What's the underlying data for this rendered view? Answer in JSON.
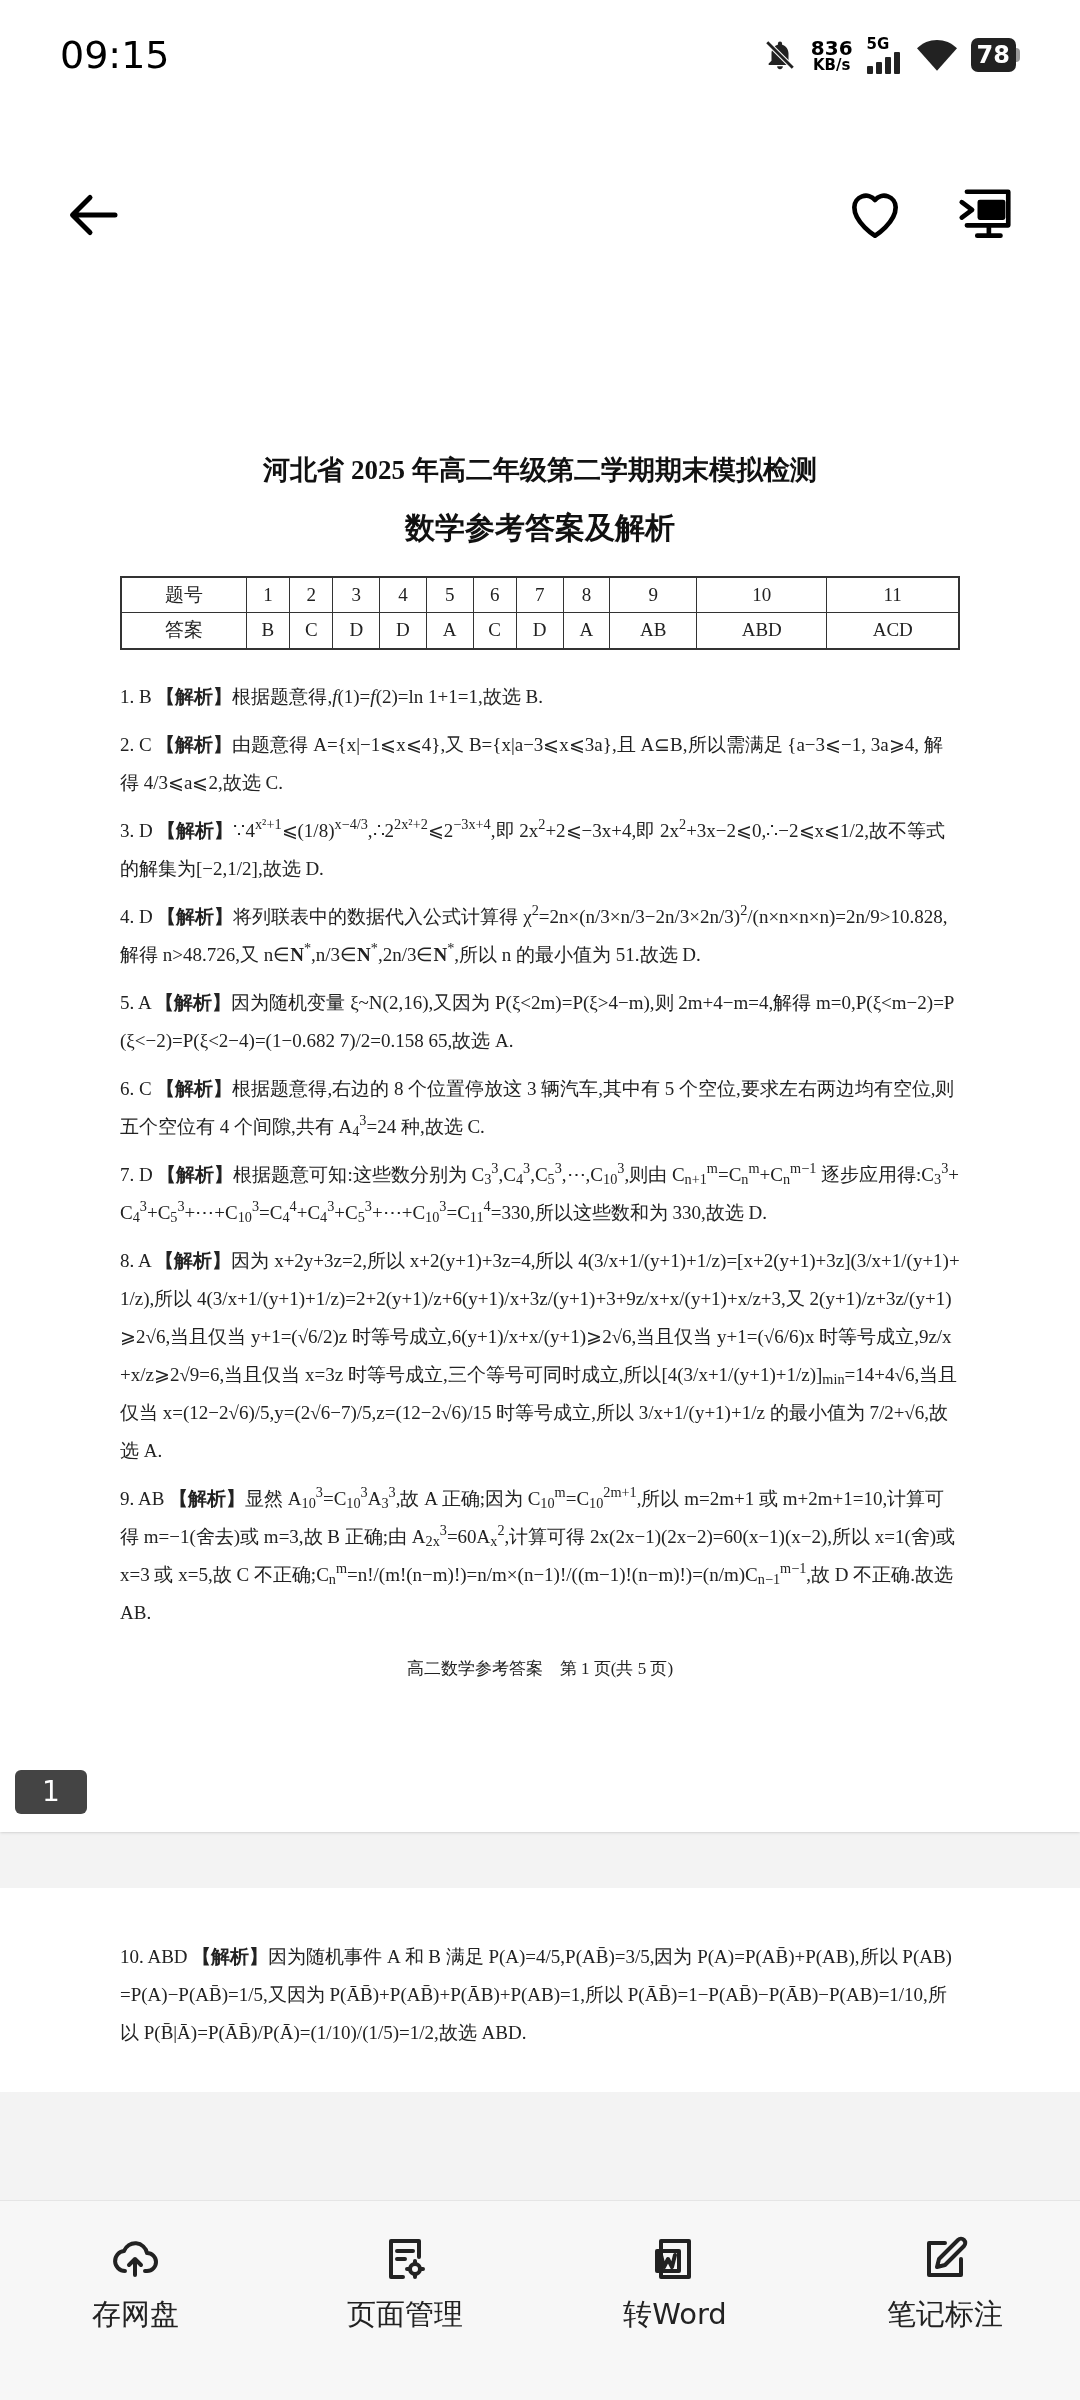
{
  "status_bar": {
    "time": "09:15",
    "speed_value": "836",
    "speed_unit": "KB/s",
    "network": "5G",
    "battery": "78"
  },
  "document": {
    "pages": [
      {
        "title": "河北省 2025 年高二年级第二学期期末模拟检测",
        "subtitle": "数学参考答案及解析",
        "answer_table": {
          "rows": [
            [
              "题号",
              "1",
              "2",
              "3",
              "4",
              "5",
              "6",
              "7",
              "8",
              "9",
              "10",
              "11"
            ],
            [
              "答案",
              "B",
              "C",
              "D",
              "D",
              "A",
              "C",
              "D",
              "A",
              "AB",
              "ABD",
              "ACD"
            ]
          ]
        },
        "solutions": [
          {
            "text": "1. B  **【解析】**根据题意得,*f*(1)=*f*(2)=ln 1+1=1,故选 B."
          },
          {
            "text": "2. C  **【解析】**由题意得 A={x|−1⩽x⩽4},又 B={x|a−3⩽x⩽3a},且 A⊆B,所以需满足 {a−3⩽−1, 3a⩾4, 解得 4/3⩽a⩽2,故选 C."
          },
          {
            "text": "3. D  **【解析】**∵4$^{x²+1}$⩽(1/8)$^{x−4/3}$,∴2$^{2x²+2}$⩽2$^{−3x+4}$,即 2x$^{2}$+2⩽−3x+4,即 2x$^{2}$+3x−2⩽0,∴−2⩽x⩽1/2,故不等式的解集为[−2,1/2],故选 D."
          },
          {
            "text": "4. D  **【解析】**将列联表中的数据代入公式计算得 χ$^{2}$=2n×(n/3×n/3−2n/3×2n/3)$^{2}$/(n×n×n×n)=2n/9>10.828,解得 n>48.726,又 n∈**N**$^{*}$,n/3∈**N**$^{*}$,2n/3∈**N**$^{*}$,所以 n 的最小值为 51.故选 D."
          },
          {
            "text": "5. A  **【解析】**因为随机变量 ξ~N(2,16),又因为 P(ξ<2m)=P(ξ>4−m),则 2m+4−m=4,解得 m=0,P(ξ<m−2)=P(ξ<−2)=P(ξ<2−4)=(1−0.682 7)/2=0.158 65,故选 A."
          },
          {
            "text": "6. C  **【解析】**根据题意得,右边的 8 个位置停放这 3 辆汽车,其中有 5 个空位,要求左右两边均有空位,则五个空位有 4 个间隙,共有 A$_{4}$$^{3}$=24 种,故选 C."
          },
          {
            "text": "7. D  **【解析】**根据题意可知:这些数分别为 C$_{3}$$^{3}$,C$_{4}$$^{3}$,C$_{5}$$^{3}$,⋯,C$_{10}$$^{3}$,则由 C$_{n+1}$$^{m}$=C$_{n}$$^{m}$+C$_{n}$$^{m−1}$ 逐步应用得:C$_{3}$$^{3}$+C$_{4}$$^{3}$+C$_{5}$$^{3}$+⋯+C$_{10}$$^{3}$=C$_{4}$$^{4}$+C$_{4}$$^{3}$+C$_{5}$$^{3}$+⋯+C$_{10}$$^{3}$=C$_{11}$$^{4}$=330,所以这些数和为 330,故选 D."
          },
          {
            "text": "8. A  **【解析】**因为 x+2y+3z=2,所以 x+2(y+1)+3z=4,所以 4(3/x+1/(y+1)+1/z)=[x+2(y+1)+3z](3/x+1/(y+1)+1/z),所以 4(3/x+1/(y+1)+1/z)=2+2(y+1)/z+6(y+1)/x+3z/(y+1)+3+9z/x+x/(y+1)+x/z+3,又 2(y+1)/z+3z/(y+1)⩾2√6,当且仅当 y+1=(√6/2)z 时等号成立,6(y+1)/x+x/(y+1)⩾2√6,当且仅当 y+1=(√6/6)x 时等号成立,9z/x+x/z⩾2√9=6,当且仅当 x=3z 时等号成立,三个等号可同时成立,所以[4(3/x+1/(y+1)+1/z)]$_{min}$=14+4√6,当且仅当 x=(12−2√6)/5,y=(2√6−7)/5,z=(12−2√6)/15 时等号成立,所以 3/x+1/(y+1)+1/z 的最小值为 7/2+√6,故选 A."
          },
          {
            "text": "9. AB  **【解析】**显然 A$_{10}$$^{3}$=C$_{10}$$^{3}$A$_{3}$$^{3}$,故 A 正确;因为 C$_{10}$$^{m}$=C$_{10}$$^{2m+1}$,所以 m=2m+1 或 m+2m+1=10,计算可得 m=−1(舍去)或 m=3,故 B 正确;由 A$_{2x}$$^{3}$=60A$_{x}$$^{2}$,计算可得 2x(2x−1)(2x−2)=60(x−1)(x−2),所以 x=1(舍)或 x=3 或 x=5,故 C 不正确;C$_{n}$$^{m}$=n!/(m!(n−m)!)=n/m×(n−1)!/((m−1)!(n−m)!)=(n/m)C$_{n−1}$$^{m−1}$,故 D 不正确.故选 AB."
          }
        ],
        "footer": "高二数学参考答案　第 1 页(共 5 页)",
        "page_badge": "1"
      },
      {
        "solutions": [
          {
            "text": "10. ABD  **【解析】**因为随机事件 A 和 B 满足 P(A)=4/5,P(AB̄)=3/5,因为 P(A)=P(AB̄)+P(AB),所以 P(AB)=P(A)−P(AB̄)=1/5,又因为 P(ĀB̄)+P(AB̄)+P(ĀB)+P(AB)=1,所以 P(ĀB̄)=1−P(AB̄)−P(ĀB)−P(AB)=1/10,所以 P(B̄|Ā)=P(ĀB̄)/P(Ā)=(1/10)/(1/5)=1/2,故选 ABD."
          }
        ]
      }
    ]
  },
  "toolbar": [
    {
      "label": "存网盘"
    },
    {
      "label": "页面管理"
    },
    {
      "label": "转Word"
    },
    {
      "label": "笔记标注"
    }
  ]
}
